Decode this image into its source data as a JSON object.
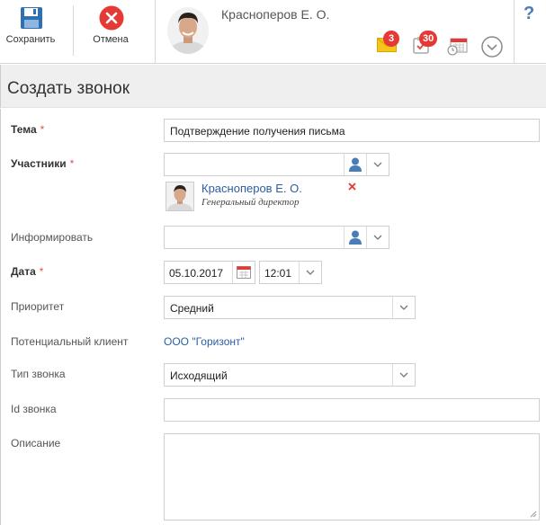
{
  "toolbar": {
    "save_label": "Сохранить",
    "cancel_label": "Отмена"
  },
  "user": {
    "name": "Красноперов Е. О.",
    "mail_count": "3",
    "tasks_count": "30"
  },
  "page": {
    "title": "Создать звонок"
  },
  "form": {
    "topic": {
      "label": "Тема",
      "value": "Подтверждение получения письма"
    },
    "participants": {
      "label": "Участники",
      "value": "",
      "person_name": "Красноперов Е. О.",
      "person_role": "Генеральный директор"
    },
    "inform": {
      "label": "Информировать",
      "value": ""
    },
    "date": {
      "label": "Дата",
      "date_value": "05.10.2017",
      "time_value": "12:01"
    },
    "priority": {
      "label": "Приоритет",
      "value": "Средний"
    },
    "client": {
      "label": "Потенциальный клиент",
      "value": "ООО \"Горизонт\""
    },
    "call_type": {
      "label": "Тип звонка",
      "value": "Исходящий"
    },
    "call_id": {
      "label": "Id звонка",
      "value": ""
    },
    "description": {
      "label": "Описание",
      "value": ""
    },
    "required_mark": "*"
  },
  "colors": {
    "accent": "#4a7db8",
    "badge": "#e53935",
    "required": "#d9534f",
    "link": "#2b5ea3"
  }
}
